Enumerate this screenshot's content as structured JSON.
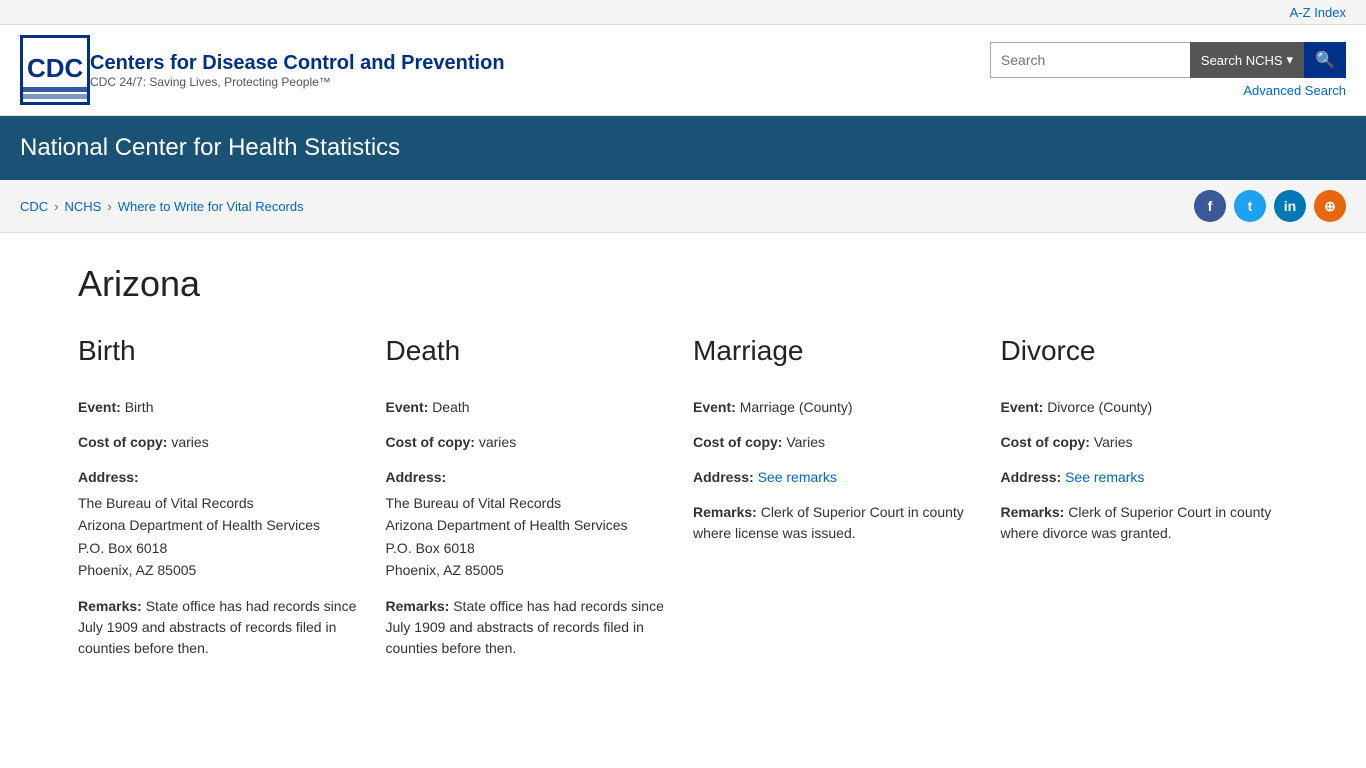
{
  "utility_bar": {
    "az_index": "A-Z Index"
  },
  "header": {
    "agency_name": "Centers for Disease Control and Prevention",
    "agency_tagline": "CDC 24/7: Saving Lives, Protecting People™",
    "search_placeholder": "Search",
    "search_button_label": "Search NCHS",
    "search_submit_icon": "🔍",
    "advanced_search_label": "Advanced Search"
  },
  "blue_banner": {
    "title": "National Center for Health Statistics"
  },
  "breadcrumb": {
    "items": [
      {
        "label": "CDC",
        "url": "#"
      },
      {
        "label": "NCHS",
        "url": "#"
      },
      {
        "label": "Where to Write for Vital Records",
        "url": "#"
      }
    ]
  },
  "social": {
    "facebook_label": "f",
    "twitter_label": "t",
    "linkedin_label": "in",
    "syndication_label": "⊕"
  },
  "page_title": "Arizona",
  "columns": [
    {
      "id": "birth",
      "heading": "Birth",
      "event_label": "Event:",
      "event_value": "Birth",
      "cost_label": "Cost of copy:",
      "cost_value": "varies",
      "address_label": "Address:",
      "address_lines": [
        "The Bureau of Vital Records",
        "Arizona Department of Health Services",
        "P.O. Box 6018",
        "Phoenix, AZ 85005"
      ],
      "remarks_label": "Remarks:",
      "remarks_value": "State office has had records since July 1909 and abstracts of records filed in counties before then.",
      "remarks_is_link": false
    },
    {
      "id": "death",
      "heading": "Death",
      "event_label": "Event:",
      "event_value": "Death",
      "cost_label": "Cost of copy:",
      "cost_value": "varies",
      "address_label": "Address:",
      "address_lines": [
        "The Bureau of Vital Records",
        "Arizona Department of Health Services",
        "P.O. Box 6018",
        "Phoenix, AZ 85005"
      ],
      "remarks_label": "Remarks:",
      "remarks_value": "State office has had records since July 1909 and abstracts of records filed in counties before then.",
      "remarks_is_link": false
    },
    {
      "id": "marriage",
      "heading": "Marriage",
      "event_label": "Event:",
      "event_value": "Marriage (County)",
      "cost_label": "Cost of copy:",
      "cost_value": "Varies",
      "address_label": "Address:",
      "address_value": "See remarks",
      "remarks_label": "Remarks:",
      "remarks_value": "Clerk of Superior Court in county where license was issued.",
      "remarks_is_link": false
    },
    {
      "id": "divorce",
      "heading": "Divorce",
      "event_label": "Event:",
      "event_value": "Divorce (County)",
      "cost_label": "Cost of copy:",
      "cost_value": "Varies",
      "address_label": "Address:",
      "address_value": "See remarks",
      "remarks_label": "Remarks:",
      "remarks_value": "Clerk of Superior Court in county where divorce was granted.",
      "remarks_is_link": false
    }
  ]
}
